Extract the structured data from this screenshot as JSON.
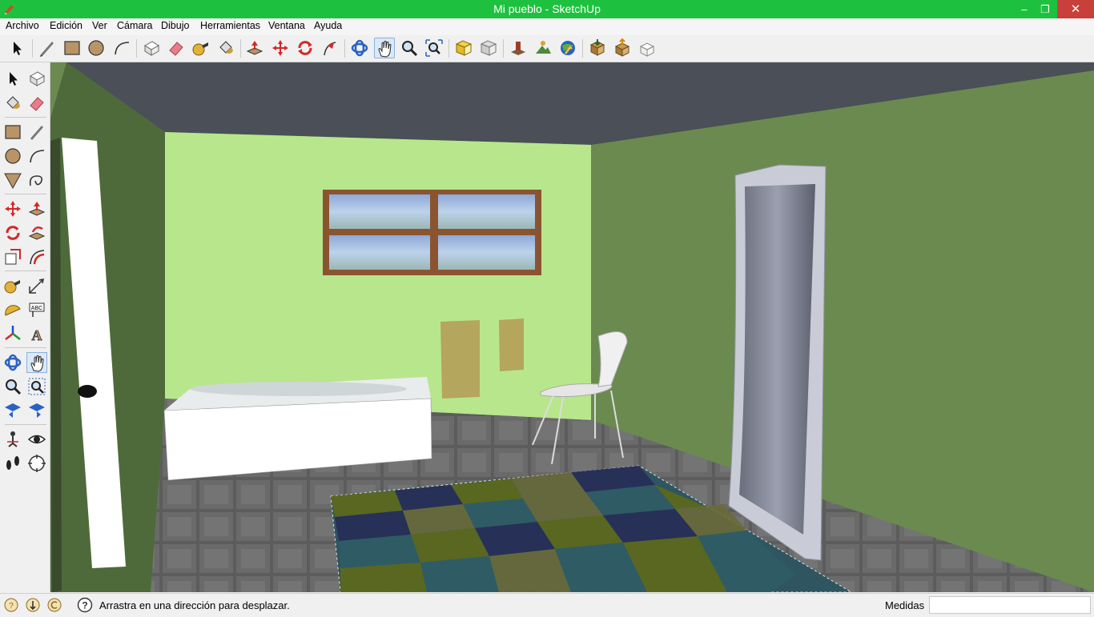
{
  "window": {
    "title": "Mi pueblo - SketchUp",
    "minimize_glyph": "–",
    "restore_glyph": "❐",
    "close_glyph": "✕",
    "accent": "#1ec13f",
    "close_color": "#c7403a"
  },
  "menu": {
    "items": [
      {
        "label": "Archivo"
      },
      {
        "label": "Edición"
      },
      {
        "label": "Ver"
      },
      {
        "label": "Cámara"
      },
      {
        "label": "Dibujo"
      },
      {
        "label": "Herramientas"
      },
      {
        "label": "Ventana"
      },
      {
        "label": "Ayuda"
      }
    ]
  },
  "toolbar": {
    "tools": [
      {
        "icon": "select-arrow-icon"
      },
      {
        "icon": "pencil-line-icon"
      },
      {
        "icon": "rectangle-icon"
      },
      {
        "icon": "circle-icon"
      },
      {
        "icon": "arc-icon"
      },
      {
        "icon": "make-component-icon"
      },
      {
        "icon": "eraser-icon"
      },
      {
        "icon": "tape-measure-icon"
      },
      {
        "icon": "paint-bucket-icon"
      },
      {
        "icon": "push-pull-icon"
      },
      {
        "icon": "move-icon"
      },
      {
        "icon": "rotate-icon"
      },
      {
        "icon": "follow-me-icon"
      },
      {
        "icon": "orbit-icon"
      },
      {
        "icon": "pan-hand-icon",
        "active": true
      },
      {
        "icon": "zoom-icon"
      },
      {
        "icon": "zoom-extents-icon"
      },
      {
        "icon": "previous-view-icon"
      },
      {
        "icon": "next-view-icon"
      },
      {
        "icon": "add-location-icon"
      },
      {
        "icon": "terrain-icon"
      },
      {
        "icon": "google-earth-icon"
      },
      {
        "icon": "get-models-icon"
      },
      {
        "icon": "share-model-icon"
      },
      {
        "icon": "share-component-icon"
      }
    ]
  },
  "left_toolbar": {
    "tools": [
      {
        "icon": "select-arrow-icon"
      },
      {
        "icon": "make-component-icon"
      },
      {
        "icon": "paint-bucket-icon"
      },
      {
        "icon": "eraser-icon"
      },
      {
        "icon": "rectangle-icon"
      },
      {
        "icon": "line-icon"
      },
      {
        "icon": "circle-icon"
      },
      {
        "icon": "arc-icon"
      },
      {
        "icon": "polygon-icon"
      },
      {
        "icon": "freehand-icon"
      },
      {
        "icon": "move-icon"
      },
      {
        "icon": "push-pull-icon"
      },
      {
        "icon": "rotate-icon"
      },
      {
        "icon": "follow-me-icon"
      },
      {
        "icon": "scale-icon"
      },
      {
        "icon": "offset-icon"
      },
      {
        "icon": "tape-measure-icon"
      },
      {
        "icon": "dimension-icon"
      },
      {
        "icon": "protractor-icon"
      },
      {
        "icon": "text-icon"
      },
      {
        "icon": "axes-icon"
      },
      {
        "icon": "3d-text-icon"
      },
      {
        "icon": "orbit-icon"
      },
      {
        "icon": "pan-hand-icon",
        "active": true
      },
      {
        "icon": "zoom-icon"
      },
      {
        "icon": "zoom-window-icon"
      },
      {
        "icon": "previous-view-icon"
      },
      {
        "icon": "zoom-extents-icon"
      },
      {
        "icon": "position-camera-icon"
      },
      {
        "icon": "look-around-eye-icon"
      },
      {
        "icon": "walk-footprints-icon"
      },
      {
        "icon": "section-plane-icon"
      }
    ],
    "labels": {
      "abc_text": "ABC",
      "a3d_text": "A"
    }
  },
  "scene": {
    "description_colors": {
      "ceiling": "#4b4f57",
      "back_wall": "#b8e68c",
      "right_wall": "#6a8a50",
      "left_wall": "#4e6a3a",
      "floor": "#5a5a5a",
      "tub": "#ffffff",
      "towel": "#b4a65c",
      "door": "#ffffff"
    }
  },
  "status": {
    "icons": [
      "geo-location-icon",
      "credits-icon",
      "copyright-icon",
      "help-icon"
    ],
    "message": "Arrastra en una dirección para desplazar.",
    "measure_label": "Medidas",
    "measure_value": ""
  }
}
